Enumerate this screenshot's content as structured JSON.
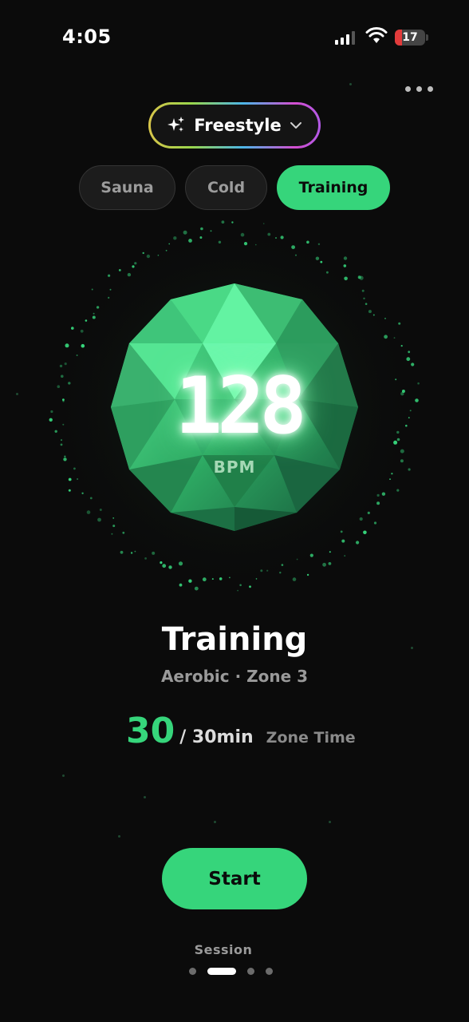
{
  "status_bar": {
    "time": "4:05",
    "battery": "17"
  },
  "mode_selector": {
    "label": "Freestyle",
    "icon": "sparkles-icon"
  },
  "tabs": [
    {
      "label": "Sauna",
      "active": false
    },
    {
      "label": "Cold",
      "active": false
    },
    {
      "label": "Training",
      "active": true
    }
  ],
  "heart_rate": {
    "value": "128",
    "unit": "BPM"
  },
  "session": {
    "title": "Training",
    "subtitle": "Aerobic · Zone 3",
    "zone_current": "30",
    "zone_target": "/ 30min",
    "zone_label": "Zone Time",
    "start_label": "Start",
    "footer_label": "Session"
  },
  "pager": {
    "count": 4,
    "active_index": 1
  },
  "colors": {
    "accent": "#36d57b",
    "background": "#0b0b0b"
  }
}
